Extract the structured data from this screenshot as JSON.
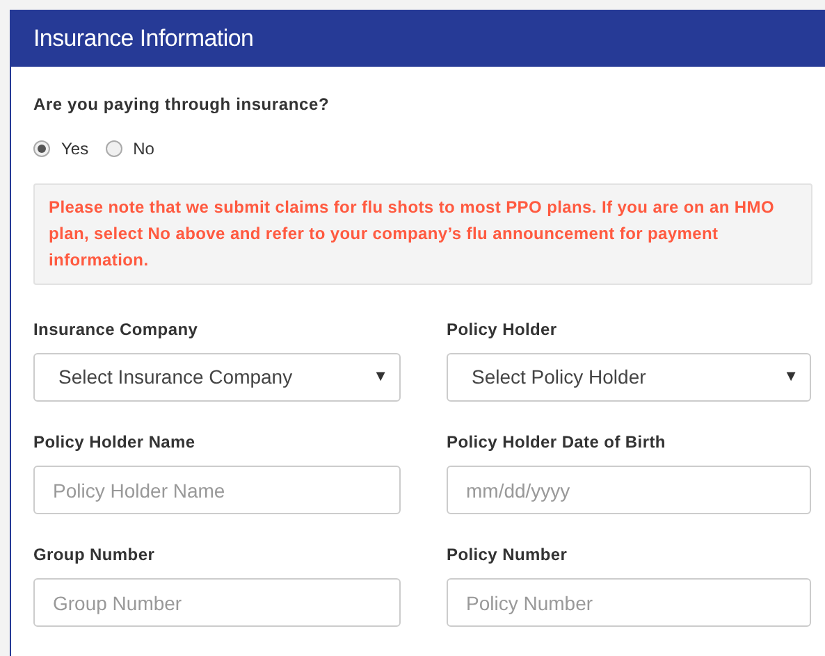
{
  "panel": {
    "title": "Insurance Information"
  },
  "question": {
    "label": "Are you paying through insurance?",
    "options": [
      {
        "label": "Yes",
        "selected": true
      },
      {
        "label": "No",
        "selected": false
      }
    ]
  },
  "notice": "Please note that we submit claims for flu shots to most PPO plans. If you are on an HMO plan, select No above and refer to your company’s flu announcement for payment information.",
  "fields": [
    {
      "kind": "select",
      "label": "Insurance Company",
      "value": "Select Insurance Company",
      "arrow": "▼"
    },
    {
      "kind": "select",
      "label": "Policy Holder",
      "value": "Select Policy Holder",
      "arrow": "▼"
    },
    {
      "kind": "text",
      "label": "Policy Holder Name",
      "placeholder": "Policy Holder Name"
    },
    {
      "kind": "text",
      "label": "Policy Holder Date of Birth",
      "placeholder": "mm/dd/yyyy"
    },
    {
      "kind": "text",
      "label": "Group Number",
      "placeholder": "Group Number"
    },
    {
      "kind": "text",
      "label": "Policy Number",
      "placeholder": "Policy Number"
    }
  ]
}
